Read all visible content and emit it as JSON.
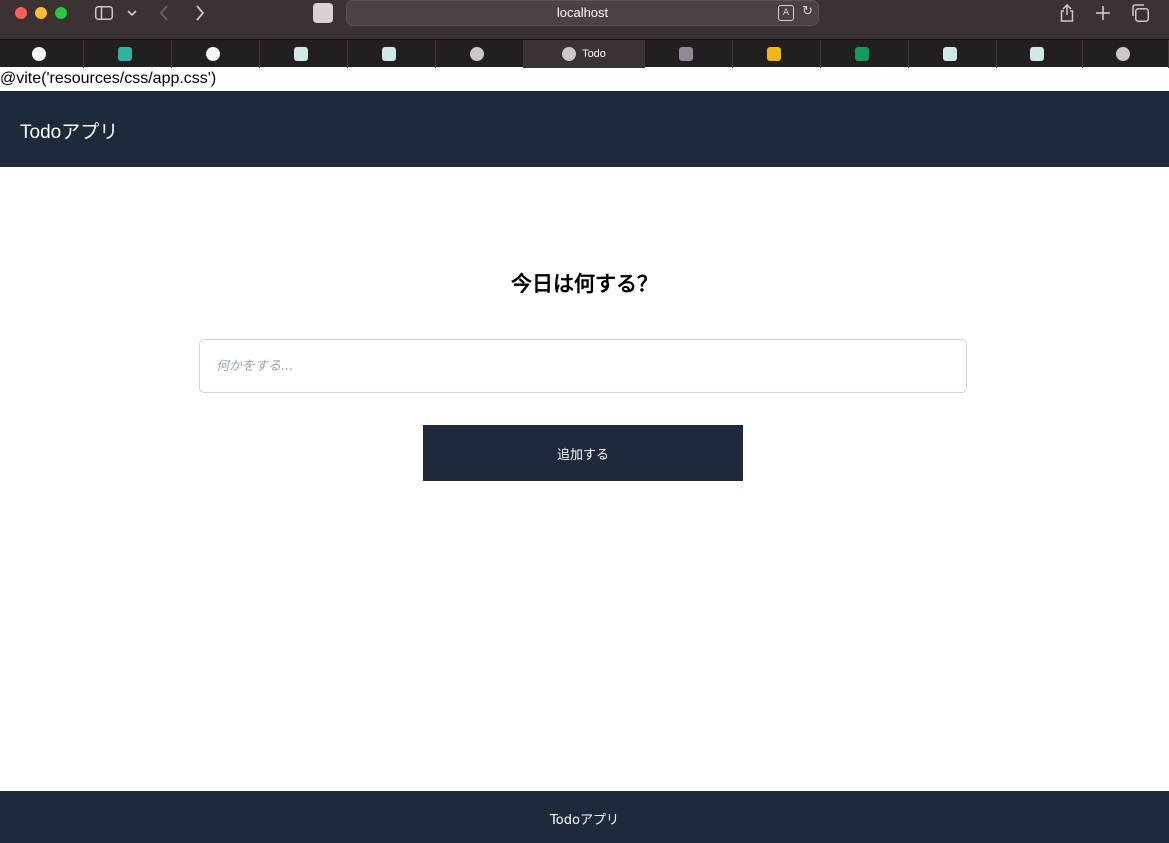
{
  "browser": {
    "url": "localhost",
    "translate_glyph": "A",
    "reload_glyph": "↻",
    "tabs": [
      {
        "icon": "github-icon",
        "color": "#f5f5f5",
        "title": ""
      },
      {
        "icon": "app-icon",
        "color": "#2bb5a0",
        "title": ""
      },
      {
        "icon": "github-icon",
        "color": "#f5f5f5",
        "title": ""
      },
      {
        "icon": "image-icon",
        "color": "#cde9e5",
        "title": ""
      },
      {
        "icon": "image-icon",
        "color": "#cde9e5",
        "title": ""
      },
      {
        "icon": "elephant-icon",
        "color": "#c9c9c9",
        "title": ""
      },
      {
        "icon": "elephant-icon",
        "color": "#c9c9c9",
        "title": "Todo",
        "active": true
      },
      {
        "icon": "e-icon",
        "color": "#8d8b93",
        "title": ""
      },
      {
        "icon": "drive-icon",
        "color": "#f2b90c",
        "title": ""
      },
      {
        "icon": "sheets-icon",
        "color": "#0f9d58",
        "title": ""
      },
      {
        "icon": "image-icon",
        "color": "#cde9e5",
        "title": ""
      },
      {
        "icon": "image-icon",
        "color": "#cde9e5",
        "title": ""
      },
      {
        "icon": "elephant-icon",
        "color": "#c9c9c9",
        "title": ""
      }
    ]
  },
  "page": {
    "vite_directive": "@vite('resources/css/app.css')",
    "header_brand": "Todoアプリ",
    "heading": "今日は何する？",
    "input_placeholder": "何かをする...",
    "input_value": "",
    "add_button_label": "追加する",
    "footer_text": "Todoアプリ"
  },
  "colors": {
    "header_bg": "#1e293b",
    "button_bg": "#1e293b",
    "footer_bg": "#1e293b"
  }
}
